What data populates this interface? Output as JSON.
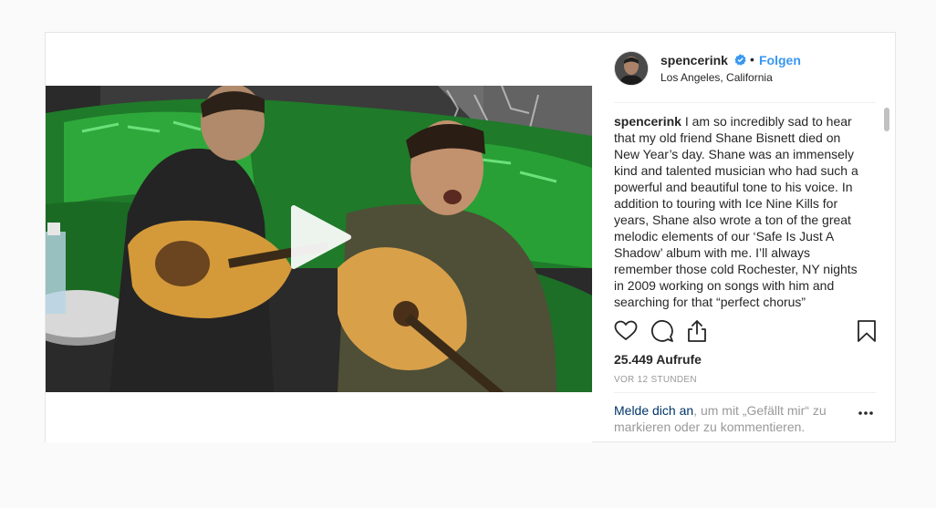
{
  "post": {
    "username": "spencerink",
    "separator": "•",
    "follow_label": "Folgen",
    "location": "Los Angeles, California",
    "caption_username": "spencerink",
    "caption_text": "I am so incredibly sad to hear that my old friend Shane Bisnett died on New Year’s day. Shane was an immensely kind and talented musician who had such a powerful and beautiful tone to his voice. In addition to touring with Ice Nine Kills for years, Shane also wrote a ton of the great melodic elements of our ‘Safe Is Just A Shadow’ album with me. I’ll always remember those cold Rochester, NY nights in 2009 working on songs with him and searching for that “perfect chorus”",
    "views": "25.449 Aufrufe",
    "timestamp": "VOR 12 STUNDEN",
    "login_link": "Melde dich an",
    "login_text": ", um mit „Gefällt mir“ zu markieren oder zu kommentieren."
  },
  "icons": {
    "verified": "verified-badge-icon",
    "like": "heart-icon",
    "comment": "comment-icon",
    "share": "share-icon",
    "save": "bookmark-icon",
    "more": "more-options-icon",
    "play": "play-icon"
  },
  "colors": {
    "link_blue": "#3897f0",
    "dark_link": "#003569",
    "muted": "#999999",
    "text": "#262626"
  }
}
